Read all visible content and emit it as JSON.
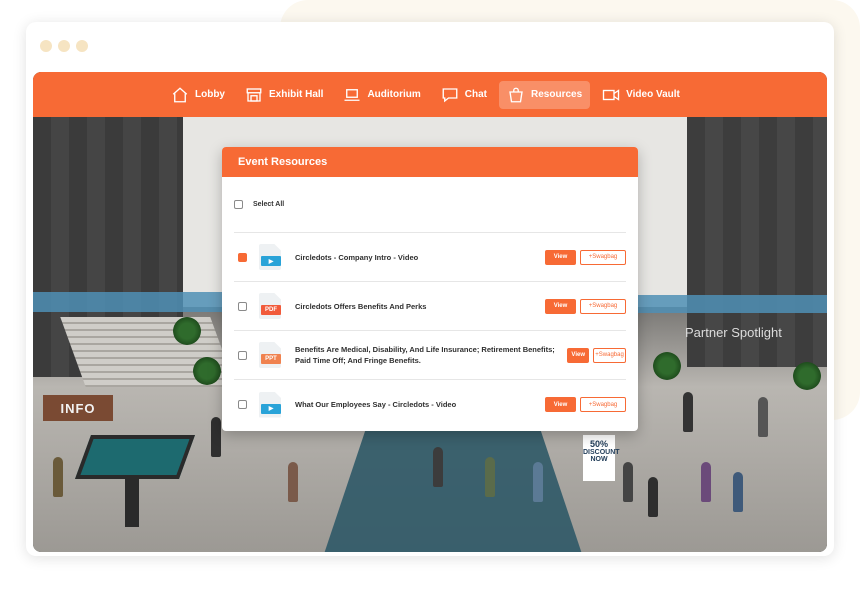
{
  "nav": {
    "items": [
      {
        "label": "Lobby",
        "icon": "home-icon",
        "active": false
      },
      {
        "label": "Exhibit Hall",
        "icon": "storefront-icon",
        "active": false
      },
      {
        "label": "Auditorium",
        "icon": "laptop-icon",
        "active": false
      },
      {
        "label": "Chat",
        "icon": "chat-bubble-icon",
        "active": false
      },
      {
        "label": "Resources",
        "icon": "shopping-bag-icon",
        "active": true
      },
      {
        "label": "Video Vault",
        "icon": "video-camera-icon",
        "active": false
      }
    ]
  },
  "scene": {
    "info_sign": "INFO",
    "partner_sign": "Partner Spotlight",
    "banner_big": "50%",
    "banner_small": "DISCOUNT NOW"
  },
  "resources": {
    "title": "Event Resources",
    "select_all_label": "Select All",
    "view_label": "View",
    "swag_label": "+Swagbag",
    "items": [
      {
        "title": "Circledots - Company Intro - Video",
        "type": "video",
        "checked": true
      },
      {
        "title": "Circledots Offers Benefits And Perks",
        "type": "PDF",
        "checked": false
      },
      {
        "title": "Benefits Are Medical, Disability, And Life Insurance; Retirement Benefits; Paid Time Off; And Fringe Benefits.",
        "type": "PPT",
        "checked": false
      },
      {
        "title": "What Our Employees Say - Circledots - Video",
        "type": "video",
        "checked": false
      }
    ]
  },
  "colors": {
    "accent": "#f76a35",
    "video_tag": "#29a3d8",
    "pdf_tag": "#f15a3a",
    "ppt_tag": "#f0824f"
  }
}
